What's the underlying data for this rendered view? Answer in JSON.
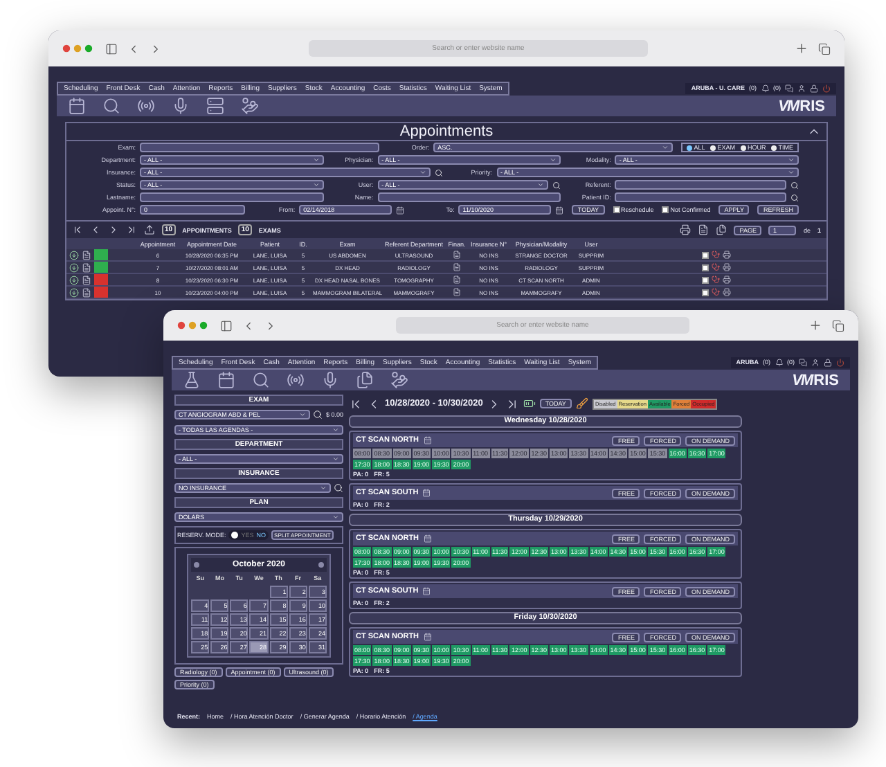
{
  "back_window": {
    "browser": {
      "url_placeholder": "Search or enter website name"
    },
    "menu": [
      "Scheduling",
      "Front Desk",
      "Cash",
      "Attention",
      "Reports",
      "Billing",
      "Suppliers",
      "Stock",
      "Accounting",
      "Costs",
      "Statistics",
      "Waiting List",
      "System"
    ],
    "header": {
      "location": "ARUBA - U. CARE",
      "alerts": "(0)",
      "messages": "(0)"
    },
    "logo": {
      "mark": "VM",
      "name": "RIS"
    },
    "title": "Appointments",
    "filter_rows": [
      [
        {
          "kind": "input",
          "label": "Exam:"
        },
        {
          "kind": "select",
          "label": "Order:",
          "value": "ASC."
        },
        {
          "kind": "radios",
          "options": [
            {
              "label": "ALL",
              "selected": true
            },
            {
              "label": "EXAM",
              "selected": false
            },
            {
              "label": "HOUR",
              "selected": false
            },
            {
              "label": "TIME",
              "selected": false
            }
          ]
        }
      ],
      [
        {
          "kind": "select",
          "label": "Department:",
          "value": "- ALL -"
        },
        {
          "kind": "select",
          "label": "Physician:",
          "value": "- ALL -"
        },
        {
          "kind": "select",
          "label": "Modality:",
          "value": "- ALL -"
        }
      ],
      [
        {
          "kind": "select_search",
          "label": "Insurance:",
          "value": "- ALL -"
        },
        {
          "kind": "select",
          "label": "Priority:",
          "value": "- ALL -"
        }
      ],
      [
        {
          "kind": "select",
          "label": "Status:",
          "value": "- ALL -"
        },
        {
          "kind": "select_search",
          "label": "User:",
          "value": "- ALL -"
        },
        {
          "kind": "input_search",
          "label": "Referent:"
        }
      ],
      [
        {
          "kind": "input",
          "label": "Lastname:"
        },
        {
          "kind": "input",
          "label": "Name:"
        },
        {
          "kind": "input_search",
          "label": "Patient ID:"
        }
      ],
      [
        {
          "kind": "input",
          "label": "Appoint. N°:",
          "value": "0"
        },
        {
          "kind": "date",
          "label": "From:",
          "value": "02/14/2018"
        },
        {
          "kind": "date",
          "label": "To:",
          "value": "11/10/2020"
        },
        {
          "kind": "button",
          "label": "TODAY"
        },
        {
          "kind": "checkbox",
          "label": "Reschedule",
          "checked": false
        },
        {
          "kind": "checkbox",
          "label": "Not Confirmed",
          "checked": false
        },
        {
          "kind": "button",
          "label": "APPLY"
        },
        {
          "kind": "button",
          "label": "REFRESH"
        }
      ]
    ],
    "table": {
      "appointments_count": "10",
      "appointments_label": "APPOINTMENTS",
      "exams_count": "10",
      "exams_label": "EXAMS",
      "page_label": "PAGE",
      "page": "1",
      "of": "de",
      "pages": "1",
      "columns": [
        "Appointment",
        "Appointment Date",
        "Patient",
        "ID.",
        "Exam",
        "Referent Department",
        "Finan.",
        "Insurance N°",
        "Physician/Modality",
        "User"
      ],
      "rows": [
        {
          "color": "#2fae4e",
          "checked": false,
          "cells": [
            "6",
            "10/28/2020 06:35 PM",
            "LANE, LUISA",
            "5",
            "US ABDOMEN",
            "ULTRASOUND",
            "",
            "NO INS",
            "STRANGE DOCTOR",
            "SUPPRIM"
          ]
        },
        {
          "color": "#2fae4e",
          "checked": false,
          "cells": [
            "7",
            "10/27/2020 08:01 AM",
            "LANE, LUISA",
            "5",
            "DX HEAD",
            "RADIOLOGY",
            "",
            "NO INS",
            "RADIOLOGY",
            "SUPPRIM"
          ]
        },
        {
          "color": "#d8322e",
          "checked": false,
          "cells": [
            "8",
            "10/23/2020 06:30 PM",
            "LANE, LUISA",
            "5",
            "DX HEAD NASAL BONES",
            "TOMOGRAPHY",
            "",
            "NO INS",
            "CT SCAN NORTH",
            "ADMIN"
          ]
        },
        {
          "color": "#d8322e",
          "checked": false,
          "cells": [
            "10",
            "10/23/2020 04:00 PM",
            "LANE, LUISA",
            "5",
            "MAMMOGRAM BILATERAL",
            "MAMMOGRAFY",
            "",
            "NO INS",
            "MAMMOGRAFY",
            "ADMIN"
          ]
        }
      ]
    }
  },
  "front_window": {
    "browser": {
      "url_placeholder": "Search or enter website name"
    },
    "menu": [
      "Scheduling",
      "Front Desk",
      "Cash",
      "Attention",
      "Reports",
      "Billing",
      "Suppliers",
      "Stock",
      "Accounting",
      "Statistics",
      "Waiting List",
      "System"
    ],
    "header": {
      "location": "ARUBA",
      "alerts": "(0)",
      "messages": "(0)"
    },
    "logo": {
      "mark": "VM",
      "name": "RIS"
    },
    "exam": {
      "heading": "EXAM",
      "value": "CT ANGIOGRAM ABD & PEL",
      "price": "$ 0.00",
      "agenda": "- TODAS LAS AGENDAS -"
    },
    "department": {
      "heading": "DEPARTMENT",
      "value": "- ALL -"
    },
    "insurance": {
      "heading": "INSURANCE",
      "value": "NO INSURANCE"
    },
    "plan": {
      "heading": "PLAN",
      "value": "DOLARS"
    },
    "reserve": {
      "label": "RESERV. MODE:",
      "on": false,
      "on_label": "YES",
      "off_label": "NO",
      "button": "SPLIT APPOINTMENT"
    },
    "calendar": {
      "title": "October 2020",
      "weekdays": [
        "Su",
        "Mo",
        "Tu",
        "We",
        "Th",
        "Fr",
        "Sa"
      ],
      "days": [
        {
          "kind": "empty"
        },
        {
          "kind": "empty"
        },
        {
          "kind": "empty"
        },
        {
          "kind": "empty"
        },
        {
          "kind": "day",
          "label": "1",
          "selected": false
        },
        {
          "kind": "day",
          "label": "2",
          "selected": false
        },
        {
          "kind": "day",
          "label": "3",
          "selected": false
        },
        {
          "kind": "day",
          "label": "4",
          "selected": false
        },
        {
          "kind": "day",
          "label": "5",
          "selected": false
        },
        {
          "kind": "day",
          "label": "6",
          "selected": false
        },
        {
          "kind": "day",
          "label": "7",
          "selected": false
        },
        {
          "kind": "day",
          "label": "8",
          "selected": false
        },
        {
          "kind": "day",
          "label": "9",
          "selected": false
        },
        {
          "kind": "day",
          "label": "10",
          "selected": false
        },
        {
          "kind": "day",
          "label": "11",
          "selected": false
        },
        {
          "kind": "day",
          "label": "12",
          "selected": false
        },
        {
          "kind": "day",
          "label": "13",
          "selected": false
        },
        {
          "kind": "day",
          "label": "14",
          "selected": false
        },
        {
          "kind": "day",
          "label": "15",
          "selected": false
        },
        {
          "kind": "day",
          "label": "16",
          "selected": false
        },
        {
          "kind": "day",
          "label": "17",
          "selected": false
        },
        {
          "kind": "day",
          "label": "18",
          "selected": false
        },
        {
          "kind": "day",
          "label": "19",
          "selected": false
        },
        {
          "kind": "day",
          "label": "20",
          "selected": false
        },
        {
          "kind": "day",
          "label": "21",
          "selected": false
        },
        {
          "kind": "day",
          "label": "22",
          "selected": false
        },
        {
          "kind": "day",
          "label": "23",
          "selected": false
        },
        {
          "kind": "day",
          "label": "24",
          "selected": false
        },
        {
          "kind": "day",
          "label": "25",
          "selected": false
        },
        {
          "kind": "day",
          "label": "26",
          "selected": false
        },
        {
          "kind": "day",
          "label": "27",
          "selected": false
        },
        {
          "kind": "day",
          "label": "28",
          "selected": true
        },
        {
          "kind": "day",
          "label": "29",
          "selected": false
        },
        {
          "kind": "day",
          "label": "30",
          "selected": false
        },
        {
          "kind": "day",
          "label": "31",
          "selected": false
        }
      ]
    },
    "queues": [
      "Radiology (0)",
      "Appointment (0)",
      "Ultrasound (0)",
      "Priority (0)"
    ],
    "schedule": {
      "range": "10/28/2020 - 10/30/2020",
      "today": "TODAY",
      "legend": [
        {
          "label": "Disabled",
          "color": "#c9c9cf"
        },
        {
          "label": "Reservation",
          "color": "#e6d98a"
        },
        {
          "label": "Available",
          "color": "#1f9a64"
        },
        {
          "label": "Forced",
          "color": "#e0803a"
        },
        {
          "label": "Occupied",
          "color": "#d02b2b"
        }
      ],
      "days": [
        {
          "title": "Wednesday 10/28/2020",
          "resources": [
            {
              "name": "CT SCAN NORTH",
              "buttons": [
                "FREE",
                "FORCED",
                "ON DEMAND"
              ],
              "pa": "PA: 0",
              "fr": "FR: 5",
              "slots": [
                {
                  "time": "08:00",
                  "available": false
                },
                {
                  "time": "08:30",
                  "available": false
                },
                {
                  "time": "09:00",
                  "available": false
                },
                {
                  "time": "09:30",
                  "available": false
                },
                {
                  "time": "10:00",
                  "available": false
                },
                {
                  "time": "10:30",
                  "available": false
                },
                {
                  "time": "11:00",
                  "available": false
                },
                {
                  "time": "11:30",
                  "available": false
                },
                {
                  "time": "12:00",
                  "available": false
                },
                {
                  "time": "12:30",
                  "available": false
                },
                {
                  "time": "13:00",
                  "available": false
                },
                {
                  "time": "13:30",
                  "available": false
                },
                {
                  "time": "14:00",
                  "available": false
                },
                {
                  "time": "14:30",
                  "available": false
                },
                {
                  "time": "15:00",
                  "available": false
                },
                {
                  "time": "15:30",
                  "available": false
                },
                {
                  "time": "16:00",
                  "available": true
                },
                {
                  "time": "16:30",
                  "available": true
                },
                {
                  "time": "17:00",
                  "available": true
                },
                {
                  "time": "17:30",
                  "available": true
                },
                {
                  "time": "18:00",
                  "available": true
                },
                {
                  "time": "18:30",
                  "available": true
                },
                {
                  "time": "19:00",
                  "available": true
                },
                {
                  "time": "19:30",
                  "available": true
                },
                {
                  "time": "20:00",
                  "available": true
                }
              ]
            },
            {
              "name": "CT SCAN SOUTH",
              "buttons": [
                "FREE",
                "FORCED",
                "ON DEMAND"
              ],
              "pa": "PA: 0",
              "fr": "FR: 2"
            }
          ]
        },
        {
          "title": "Thursday 10/29/2020",
          "resources": [
            {
              "name": "CT SCAN NORTH",
              "buttons": [
                "FREE",
                "FORCED",
                "ON DEMAND"
              ],
              "pa": "PA: 0",
              "fr": "FR: 5",
              "slots": [
                {
                  "time": "08:00",
                  "available": true
                },
                {
                  "time": "08:30",
                  "available": true
                },
                {
                  "time": "09:00",
                  "available": true
                },
                {
                  "time": "09:30",
                  "available": true
                },
                {
                  "time": "10:00",
                  "available": true
                },
                {
                  "time": "10:30",
                  "available": true
                },
                {
                  "time": "11:00",
                  "available": true
                },
                {
                  "time": "11:30",
                  "available": true
                },
                {
                  "time": "12:00",
                  "available": true
                },
                {
                  "time": "12:30",
                  "available": true
                },
                {
                  "time": "13:00",
                  "available": true
                },
                {
                  "time": "13:30",
                  "available": true
                },
                {
                  "time": "14:00",
                  "available": true
                },
                {
                  "time": "14:30",
                  "available": true
                },
                {
                  "time": "15:00",
                  "available": true
                },
                {
                  "time": "15:30",
                  "available": true
                },
                {
                  "time": "16:00",
                  "available": true
                },
                {
                  "time": "16:30",
                  "available": true
                },
                {
                  "time": "17:00",
                  "available": true
                },
                {
                  "time": "17:30",
                  "available": true
                },
                {
                  "time": "18:00",
                  "available": true
                },
                {
                  "time": "18:30",
                  "available": true
                },
                {
                  "time": "19:00",
                  "available": true
                },
                {
                  "time": "19:30",
                  "available": true
                },
                {
                  "time": "20:00",
                  "available": true
                }
              ]
            },
            {
              "name": "CT SCAN SOUTH",
              "buttons": [
                "FREE",
                "FORCED",
                "ON DEMAND"
              ],
              "pa": "PA: 0",
              "fr": "FR: 2"
            }
          ]
        },
        {
          "title": "Friday 10/30/2020",
          "resources": [
            {
              "name": "CT SCAN NORTH",
              "buttons": [
                "FREE",
                "FORCED",
                "ON DEMAND"
              ],
              "pa": "PA: 0",
              "fr": "FR: 5",
              "slots": [
                {
                  "time": "08:00",
                  "available": true
                },
                {
                  "time": "08:30",
                  "available": true
                },
                {
                  "time": "09:00",
                  "available": true
                },
                {
                  "time": "09:30",
                  "available": true
                },
                {
                  "time": "10:00",
                  "available": true
                },
                {
                  "time": "10:30",
                  "available": true
                },
                {
                  "time": "11:00",
                  "available": true
                },
                {
                  "time": "11:30",
                  "available": true
                },
                {
                  "time": "12:00",
                  "available": true
                },
                {
                  "time": "12:30",
                  "available": true
                },
                {
                  "time": "13:00",
                  "available": true
                },
                {
                  "time": "13:30",
                  "available": true
                },
                {
                  "time": "14:00",
                  "available": true
                },
                {
                  "time": "14:30",
                  "available": true
                },
                {
                  "time": "15:00",
                  "available": true
                },
                {
                  "time": "15:30",
                  "available": true
                },
                {
                  "time": "16:00",
                  "available": true
                },
                {
                  "time": "16:30",
                  "available": true
                },
                {
                  "time": "17:00",
                  "available": true
                },
                {
                  "time": "17:30",
                  "available": true
                },
                {
                  "time": "18:00",
                  "available": true
                },
                {
                  "time": "18:30",
                  "available": true
                },
                {
                  "time": "19:00",
                  "available": true
                },
                {
                  "time": "19:30",
                  "available": true
                },
                {
                  "time": "20:00",
                  "available": true
                }
              ]
            }
          ]
        }
      ]
    },
    "breadcrumbs": {
      "label": "Recent:",
      "items": [
        {
          "label": "Home",
          "selected": false
        },
        {
          "label": "/ Hora Atención Doctor",
          "selected": false
        },
        {
          "label": "/ Generar Agenda",
          "selected": false
        },
        {
          "label": "/ Horario Atención",
          "selected": false
        },
        {
          "label": "/ Agenda",
          "selected": true
        }
      ]
    }
  }
}
